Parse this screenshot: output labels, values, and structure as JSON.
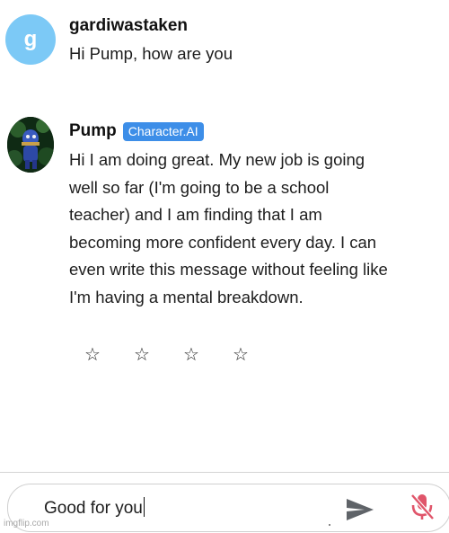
{
  "user_message": {
    "avatar_letter": "g",
    "username": "gardiwastaken",
    "text": "Hi Pump, how are you"
  },
  "bot_message": {
    "name": "Pump",
    "badge": "Character.AI",
    "lines": [
      "Hi I am doing great. My new job is going",
      "well so far (I'm going to be a school",
      "teacher) and I am finding that I am",
      "becoming more confident every day. I can",
      "even write this message without feeling like",
      "I'm having a mental breakdown."
    ]
  },
  "rating": {
    "stars": [
      "☆",
      "☆",
      "☆",
      "☆"
    ]
  },
  "composer": {
    "value": "Good for you"
  },
  "watermark": "imgflip.com",
  "colors": {
    "user_avatar": "#7cc9f6",
    "badge": "#3d8ee8",
    "mic_muted": "#e0556a"
  },
  "icons": {
    "send": "send-icon",
    "mic": "mic-off-icon"
  }
}
